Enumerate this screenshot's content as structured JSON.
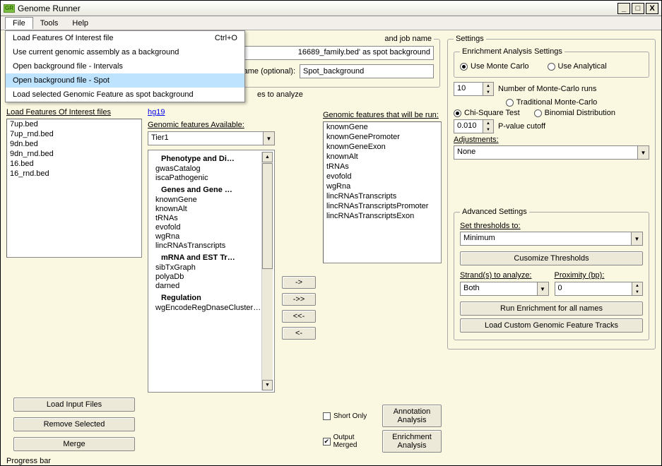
{
  "window": {
    "title": "Genome Runner"
  },
  "menubar": {
    "file": "File",
    "tools": "Tools",
    "help": "Help"
  },
  "file_menu": {
    "items": [
      {
        "label": "Load Features Of Interest file",
        "shortcut": "Ctrl+O"
      },
      {
        "label": "Use current genomic assembly as a background",
        "shortcut": ""
      },
      {
        "label": "Open background file - Intervals",
        "shortcut": ""
      },
      {
        "label": "Open background file - Spot",
        "shortcut": ""
      },
      {
        "label": "Load selected Genomic Feature as spot background",
        "shortcut": ""
      }
    ],
    "highlight_index": 3
  },
  "top_hidden": {
    "job_fragment": "and job name",
    "bg_fragment": "16689_family.bed' as spot background",
    "name_optional_label": "ame (optional):",
    "name_optional_value": "Spot_background",
    "analyze_fragment": "es to analyze"
  },
  "col1": {
    "header": "Load Features Of Interest files",
    "files": [
      "7up.bed",
      "7up_rnd.bed",
      "9dn.bed",
      "9dn_rnd.bed",
      "16.bed",
      "16_rnd.bed"
    ],
    "btn_load": "Load Input Files",
    "btn_remove": "Remove Selected",
    "btn_merge": "Merge"
  },
  "col2": {
    "genome_link": "hg19",
    "avail_header": "Genomic features Available:",
    "tier_value": "Tier1",
    "tree": {
      "cat1": "Phenotype and Di…",
      "leaves1": [
        "gwasCatalog",
        "iscaPathogenic"
      ],
      "cat2": "Genes and Gene …",
      "leaves2": [
        "knownGene",
        "knownAlt",
        "tRNAs",
        "evofold",
        "wgRna",
        "lincRNAsTranscripts"
      ],
      "cat3": "mRNA and EST Tr…",
      "leaves3": [
        "sibTxGraph",
        "polyaDb",
        "darned"
      ],
      "cat4": "Regulation",
      "leaves4": [
        "wgEncodeRegDnaseCluster…"
      ]
    }
  },
  "transfer": {
    "r1": "->",
    "r2": "->>",
    "l1": "<<-",
    "l2": "<-"
  },
  "col4": {
    "run_header": "Genomic features that will be run:",
    "items": [
      "knownGene",
      "knownGenePromoter",
      "knownGeneExon",
      "knownAlt",
      "tRNAs",
      "evofold",
      "wgRna",
      "lincRNAsTranscripts",
      "lincRNAsTranscriptsPromoter",
      "lincRNAsTranscriptsExon"
    ],
    "short_only": "Short Only",
    "output_merged": "Output Merged",
    "btn_annotation": "Annotation Analysis",
    "btn_enrichment": "Enrichment Analysis"
  },
  "settings": {
    "legend": "Settings",
    "enrich_legend": "Enrichment Analysis Settings",
    "use_monte": "Use Monte Carlo",
    "use_analytical": "Use Analytical",
    "mc_runs_value": "10",
    "mc_runs_label": "Number of Monte-Carlo runs",
    "trad_mc": "Traditional Monte-Carlo",
    "chi_sq": "Chi-Square Test",
    "binom": "Binomial Distribution",
    "pval_value": "0.010",
    "pval_label": "P-value cutoff",
    "adjust_label": "Adjustments:",
    "adjust_value": "None",
    "adv_legend": "Advanced Settings",
    "thresh_label": "Set thresholds to:",
    "thresh_value": "Minimum",
    "btn_customize": "Cusomize Thresholds",
    "strands_label": "Strand(s) to analyze:",
    "strands_value": "Both",
    "proximity_label": "Proximity (bp):",
    "proximity_value": "0",
    "btn_run_all": "Run Enrichment for all names",
    "btn_load_custom": "Load Custom Genomic Feature Tracks"
  },
  "progress": {
    "label": "Progress bar"
  }
}
